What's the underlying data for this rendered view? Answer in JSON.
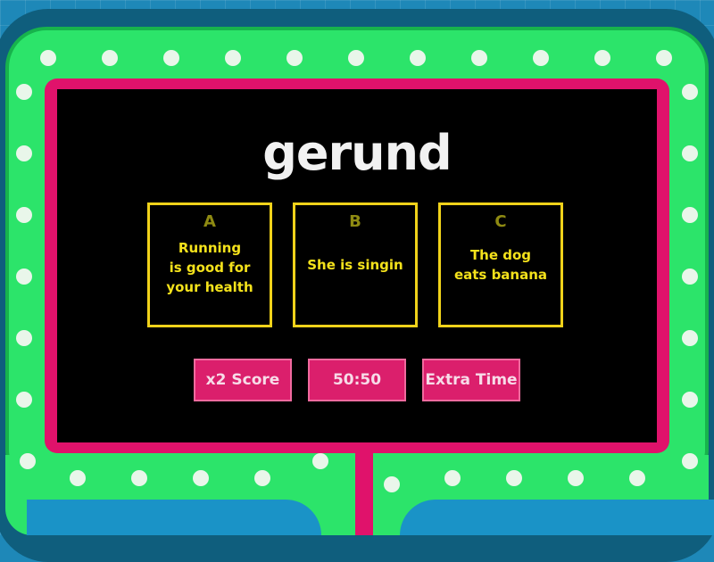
{
  "question": {
    "text": "gerund"
  },
  "answers": [
    {
      "letter": "A",
      "text": "Running\nis good for\nyour health"
    },
    {
      "letter": "B",
      "text": "She is singin"
    },
    {
      "letter": "C",
      "text": "The dog\neats banana"
    }
  ],
  "powerups": [
    {
      "label": "x2 Score"
    },
    {
      "label": "50:50"
    },
    {
      "label": "Extra Time"
    }
  ],
  "theme": {
    "background": "#1E88B8",
    "frame_green": "#2CE46A",
    "panel_pink": "#E0126B",
    "screen": "#000000",
    "answer_yellow": "#F4E21B",
    "dot_color": "#E9F6EA"
  }
}
